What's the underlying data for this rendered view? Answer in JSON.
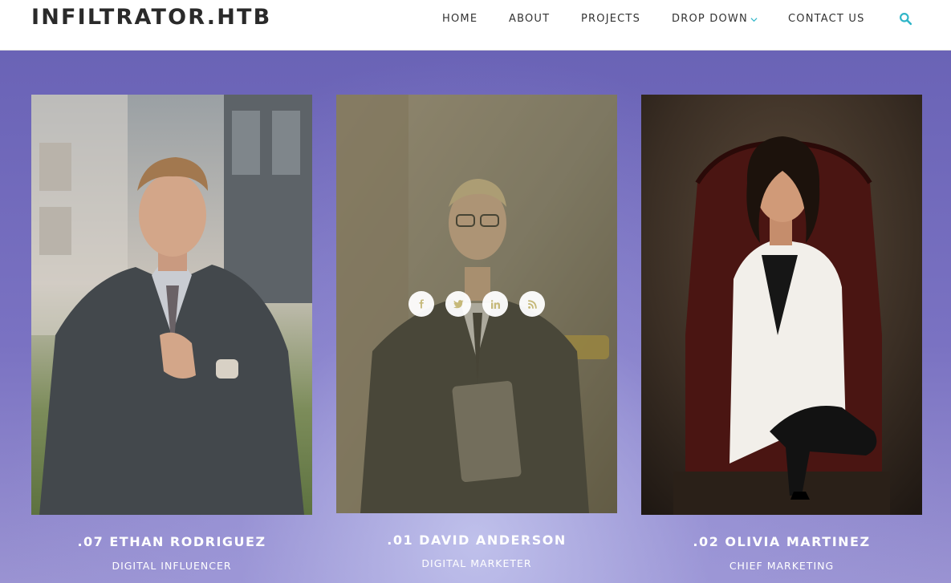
{
  "header": {
    "brand": "INFILTRATOR.HTB",
    "nav": [
      "HOME",
      "ABOUT",
      "PROJECTS",
      "DROP DOWN",
      "CONTACT US"
    ],
    "search_icon": "search-icon",
    "accent": "#2fb5c8"
  },
  "team": [
    {
      "name": ".07 ETHAN RODRIGUEZ",
      "role": "DIGITAL INFLUENCER",
      "photo": "man in grey suit adjusting tie"
    },
    {
      "name": ".01 DAVID ANDERSON",
      "role": "DIGITAL MARKETER",
      "photo": "man with glasses holding laptop",
      "social_icons": [
        "facebook-icon",
        "twitter-icon",
        "linkedin-icon",
        "rss-icon"
      ]
    },
    {
      "name": ".02 OLIVIA MARTINEZ",
      "role": "CHIEF MARKETING",
      "photo": "woman in white blazer on leather chair"
    }
  ]
}
